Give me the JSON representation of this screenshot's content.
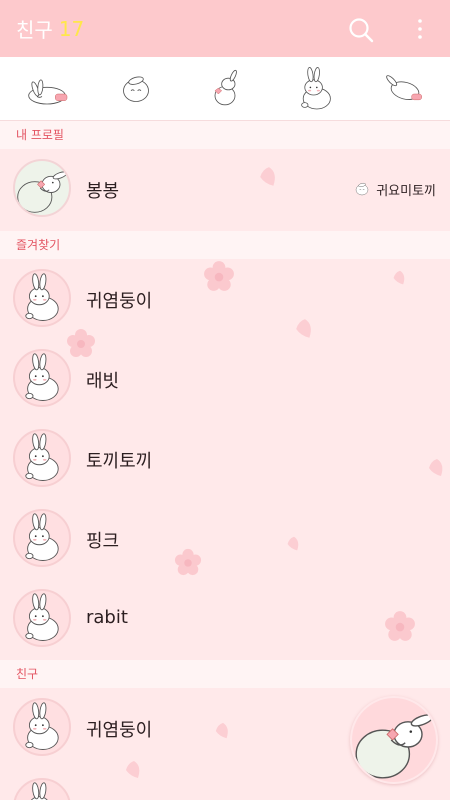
{
  "header": {
    "title": "친구",
    "count": "17",
    "icons": {
      "search": "search-icon",
      "more": "more-vertical-icon"
    }
  },
  "tabs": [
    {
      "name": "tab-friends",
      "icon": "bunny-lying-icon"
    },
    {
      "name": "tab-chats",
      "icon": "bunny-face-icon"
    },
    {
      "name": "tab-sharp",
      "icon": "bunny-heart-icon"
    },
    {
      "name": "tab-more",
      "icon": "bunny-sitting-icon"
    },
    {
      "name": "tab-settings",
      "icon": "bunny-jump-icon"
    }
  ],
  "sections": {
    "my_profile": "내 프로필",
    "favorites": "즐겨찾기",
    "friends": "친구"
  },
  "my_profile": {
    "name": "봉봉",
    "status_message": "귀요미토끼",
    "status_icon": "bunny-face-icon"
  },
  "favorites": [
    {
      "name": "귀염둥이"
    },
    {
      "name": "래빗"
    },
    {
      "name": "토끼토끼"
    },
    {
      "name": "핑크"
    },
    {
      "name": "rabit"
    }
  ],
  "friends": [
    {
      "name": "귀염둥이"
    }
  ],
  "colors": {
    "header_bg": "#fdc9cc",
    "count_color": "#ffe74a",
    "section_text": "#e35361",
    "list_bg": "#ffe9ea"
  }
}
